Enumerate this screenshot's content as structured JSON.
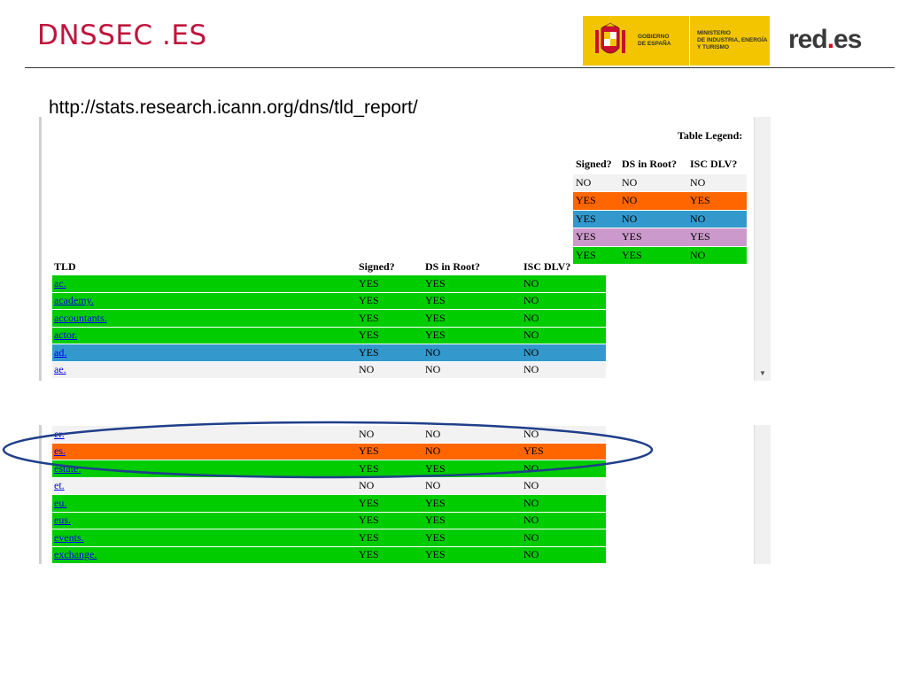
{
  "header": {
    "title": "DNSSEC .ES",
    "gov_logo": {
      "line1": [
        "GOBIERNO",
        "DE ESPAÑA"
      ],
      "line2": [
        "MINISTERIO",
        "DE INDUSTRIA, ENERGÍA",
        "Y TURISMO"
      ]
    },
    "rede_logo": {
      "pre": "red",
      "dot": ".",
      "post": "es"
    }
  },
  "url": "http://stats.research.icann.org/dns/tld_report/",
  "colors": {
    "green": "#00cc00",
    "orange": "#ff6600",
    "blue": "#3399cc",
    "violet": "#cc99cc",
    "grey": "#f2f2f2",
    "title_red": "#c0143c",
    "ellipse": "#1f3f8a"
  },
  "legend": {
    "title": "Table Legend:",
    "headers": [
      "Signed?",
      "DS in Root?",
      "ISC DLV?"
    ],
    "rows": [
      {
        "cells": [
          "NO",
          "NO",
          "NO"
        ],
        "color": "grey"
      },
      {
        "cells": [
          "YES",
          "NO",
          "YES"
        ],
        "color": "orange"
      },
      {
        "cells": [
          "YES",
          "NO",
          "NO"
        ],
        "color": "blue"
      },
      {
        "cells": [
          "YES",
          "YES",
          "YES"
        ],
        "color": "violet"
      },
      {
        "cells": [
          "YES",
          "YES",
          "NO"
        ],
        "color": "green"
      }
    ]
  },
  "table1": {
    "headers": [
      "TLD",
      "Signed?",
      "DS in Root?",
      "ISC DLV?"
    ],
    "rows": [
      {
        "tld": "ac.",
        "cells": [
          "YES",
          "YES",
          "NO"
        ],
        "color": "green"
      },
      {
        "tld": "academy.",
        "cells": [
          "YES",
          "YES",
          "NO"
        ],
        "color": "green"
      },
      {
        "tld": "accountants.",
        "cells": [
          "YES",
          "YES",
          "NO"
        ],
        "color": "green"
      },
      {
        "tld": "actor.",
        "cells": [
          "YES",
          "YES",
          "NO"
        ],
        "color": "green"
      },
      {
        "tld": "ad.",
        "cells": [
          "YES",
          "NO",
          "NO"
        ],
        "color": "blue"
      },
      {
        "tld": "ae.",
        "cells": [
          "NO",
          "NO",
          "NO"
        ],
        "color": "grey"
      }
    ]
  },
  "table2": {
    "rows": [
      {
        "tld": "er.",
        "cells": [
          "NO",
          "NO",
          "NO"
        ],
        "color": "grey"
      },
      {
        "tld": "es.",
        "cells": [
          "YES",
          "NO",
          "YES"
        ],
        "color": "orange"
      },
      {
        "tld": "estate.",
        "cells": [
          "YES",
          "YES",
          "NO"
        ],
        "color": "green"
      },
      {
        "tld": "et.",
        "cells": [
          "NO",
          "NO",
          "NO"
        ],
        "color": "grey"
      },
      {
        "tld": "eu.",
        "cells": [
          "YES",
          "YES",
          "NO"
        ],
        "color": "green"
      },
      {
        "tld": "eus.",
        "cells": [
          "YES",
          "YES",
          "NO"
        ],
        "color": "green"
      },
      {
        "tld": "events.",
        "cells": [
          "YES",
          "YES",
          "NO"
        ],
        "color": "green"
      },
      {
        "tld": "exchange.",
        "cells": [
          "YES",
          "YES",
          "NO"
        ],
        "color": "green"
      }
    ]
  }
}
